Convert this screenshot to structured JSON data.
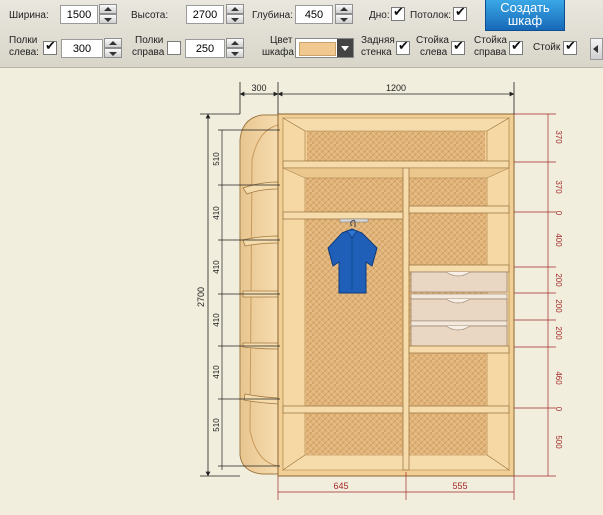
{
  "toolbar": {
    "width_label": "Ширина:",
    "width_value": "1500",
    "height_label": "Высота:",
    "height_value": "2700",
    "depth_label": "Глубина:",
    "depth_value": "450",
    "bottom_label": "Дно:",
    "ceiling_label": "Потолок:",
    "create_button_line1": "Создать",
    "create_button_line2": "шкаф",
    "left_shelves_label_1": "Полки",
    "left_shelves_label_2": "слева:",
    "left_shelves_value": "300",
    "right_shelves_label_1": "Полки",
    "right_shelves_label_2": "справа",
    "right_shelves_value": "250",
    "color_label_1": "Цвет",
    "color_label_2": "шкафа",
    "back_wall_label_1": "Задняя",
    "back_wall_label_2": "стенка",
    "left_post_label_1": "Стойка",
    "left_post_label_2": "слева",
    "right_post_label_1": "Стойка",
    "right_post_label_2": "справа",
    "post_label": "Стойк",
    "checked": {
      "bottom": true,
      "ceiling": true,
      "left_shelves": true,
      "right_shelves": false,
      "back_wall": true,
      "left_post": true,
      "right_post": true,
      "post": true
    },
    "wardrobe_color": "#f0c890"
  },
  "drawing": {
    "top_dims": [
      "300",
      "1200"
    ],
    "bottom_dims": [
      "645",
      "555"
    ],
    "height_dim": "2700",
    "left_shelf_dims": [
      "510",
      "410",
      "410",
      "410",
      "410",
      "510"
    ],
    "right_dims": [
      "370",
      "370",
      "0",
      "400",
      "200",
      "200",
      "200",
      "460",
      "0",
      "500"
    ]
  },
  "colors": {
    "wood": "#f2cf95",
    "wood_dark": "#d9ae6b",
    "back": "#e3b97e",
    "drawer": "#e9d7c4",
    "dim_red": "#a52a2a",
    "shirt": "#1f5fb8"
  }
}
